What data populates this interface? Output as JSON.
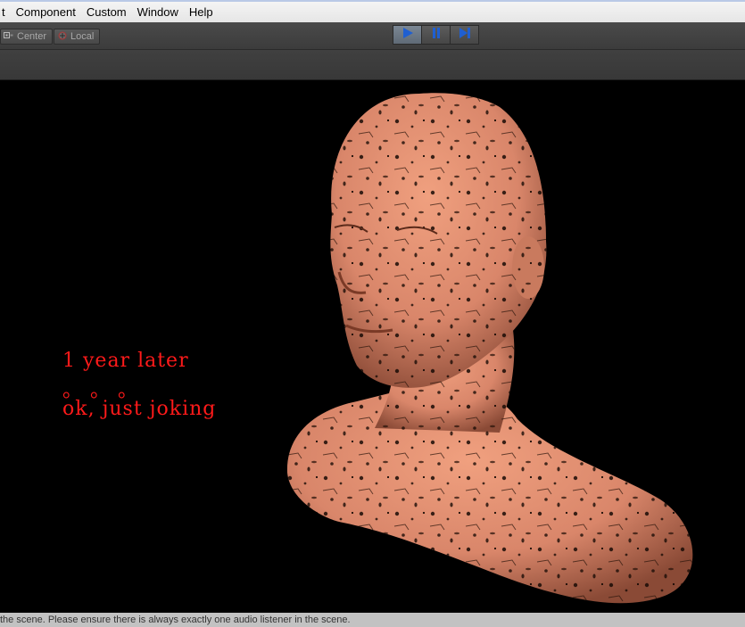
{
  "menu": {
    "items": [
      "t",
      "Component",
      "Custom",
      "Window",
      "Help"
    ]
  },
  "toolbar": {
    "pivot_label": "Center",
    "space_label": "Local",
    "play_icon": "play-icon",
    "pause_icon": "pause-icon",
    "step_icon": "step-icon",
    "accent": "#1f5fd1"
  },
  "viewport": {
    "lines": [
      "1 year later",
      "。 。 。",
      "ok, just joking"
    ],
    "text_color": "#ff1a1a",
    "skin_color": "#e28d6e"
  },
  "status": {
    "message": "the scene. Please ensure there is always exactly one audio listener in the scene."
  }
}
